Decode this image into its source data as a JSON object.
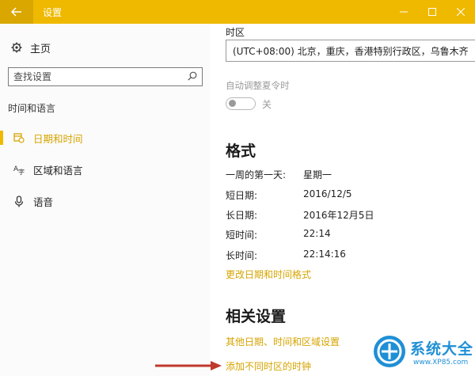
{
  "window": {
    "title": "设置",
    "accent_color": "#efb900",
    "link_color": "#d6a400"
  },
  "sidebar": {
    "home_label": "主页",
    "search_placeholder": "查找设置",
    "section_label": "时间和语言",
    "items": [
      {
        "label": "日期和时间",
        "icon": "calendar-clock-icon",
        "active": true
      },
      {
        "label": "区域和语言",
        "icon": "language-icon",
        "active": false
      },
      {
        "label": "语音",
        "icon": "microphone-icon",
        "active": false
      }
    ]
  },
  "content": {
    "timezone_label": "时区",
    "timezone_value": "(UTC+08:00) 北京，重庆，香港特别行政区，乌鲁木齐",
    "dst_label": "自动调整夏令时",
    "dst_toggle_state": "关",
    "format_heading": "格式",
    "format_rows": [
      {
        "label": "一周的第一天:",
        "value": "星期一"
      },
      {
        "label": "短日期:",
        "value": "2016/12/5"
      },
      {
        "label": "长日期:",
        "value": "2016年12月5日"
      },
      {
        "label": "短时间:",
        "value": "22:14"
      },
      {
        "label": "长时间:",
        "value": "22:14:16"
      }
    ],
    "change_format_link": "更改日期和时间格式",
    "related_heading": "相关设置",
    "related_links": [
      "其他日期、时间和区域设置",
      "添加不同时区的时钟"
    ]
  },
  "watermark": {
    "name": "系统大全",
    "url": "www.XP85.com"
  }
}
